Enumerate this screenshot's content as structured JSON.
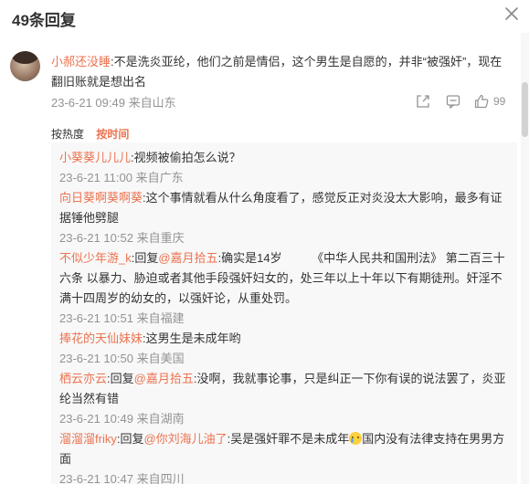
{
  "header": {
    "title": "49条回复",
    "close_icon": "close-icon"
  },
  "main_comment": {
    "username": "小郝还没睡",
    "text": ":不是洗炎亚纶，他们之前是情侣，这个男生是自愿的，并非“被强奸”，现在翻旧账就是想出名",
    "meta": "23-6-21 09:49 来自山东",
    "like_count": "99",
    "actions": [
      "share-icon",
      "comment-icon",
      "like-icon"
    ]
  },
  "sort": {
    "items": [
      "按热度",
      "按时间"
    ],
    "active_index": 1
  },
  "replies": [
    {
      "username": "小葵葵儿儿儿",
      "text": ":视频被偷拍怎么说？",
      "meta": "23-6-21 11:00 来自广东"
    },
    {
      "username": "向日葵啊葵啊葵",
      "text": ":这个事情就看从什么角度看了，感觉反正对炎没太大影响，最多有证据锤他劈腿",
      "meta": "23-6-21 10:52 来自重庆"
    },
    {
      "username": "不似少年游_k",
      "reply_prefix": ":回复",
      "reply_to": "@嘉月拾五",
      "text": ":确实是14岁　　　《中华人民共和国刑法》 第二百三十六条 以暴力、胁迫或者其他手段强奸妇女的，处三年以上十年以下有期徒刑。奸淫不满十四周岁的幼女的，以强奸论，从重处罚。",
      "meta": "23-6-21 10:51 来自福建"
    },
    {
      "username": "捧花的天仙妹妹",
      "text": ":这男生是未成年哟",
      "meta": "23-6-21 10:50 来自美国"
    },
    {
      "username": "栖云亦云",
      "reply_prefix": ":回复",
      "reply_to": "@嘉月拾五",
      "text": ":没啊，我就事论事，只是纠正一下你有误的说法罢了，炎亚纶当然有错",
      "meta": "23-6-21 10:49 来自湖南"
    },
    {
      "username": "溜溜溜friky",
      "reply_prefix": ":回复",
      "reply_to": "@你刘海儿油了",
      "text": ":吴是强奸罪不是未成年",
      "emoji": "crying-face-emoji",
      "text_after": "国内没有法律支持在男男方面",
      "meta": "23-6-21 10:47 来自四川"
    }
  ]
}
